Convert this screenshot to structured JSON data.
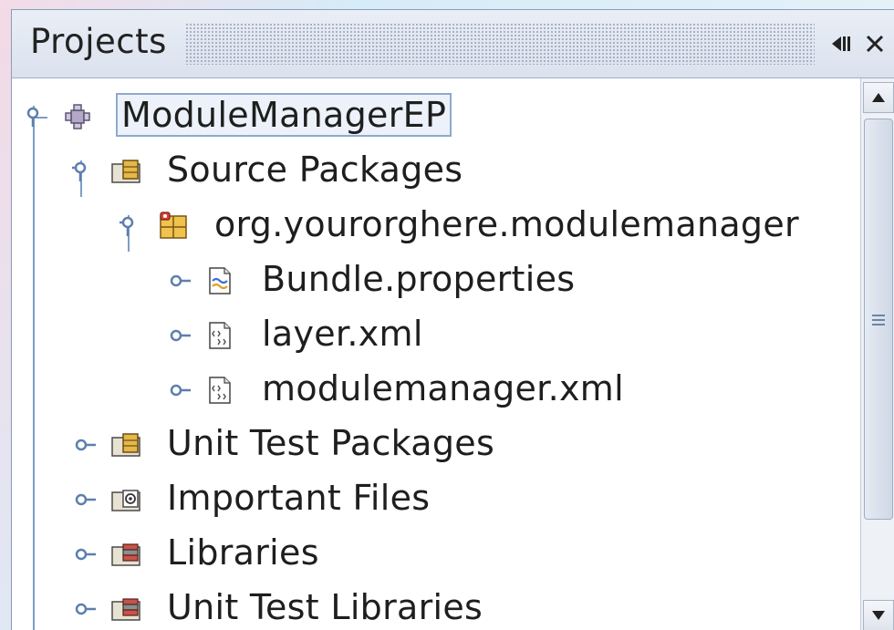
{
  "panel": {
    "title": "Projects",
    "minimize_glyph": "◀▮",
    "close_glyph": "✕"
  },
  "tree": {
    "nodes": [
      {
        "label": "ModuleManagerEP",
        "icon": "module-icon",
        "state": "expanded",
        "selected": true
      },
      {
        "label": "Source Packages",
        "icon": "package-folder-icon",
        "state": "expanded"
      },
      {
        "label": "org.yourorghere.modulemanager",
        "icon": "java-package-icon",
        "state": "expanded"
      },
      {
        "label": "Bundle.properties",
        "icon": "properties-file-icon",
        "state": "collapsed"
      },
      {
        "label": "layer.xml",
        "icon": "xml-file-icon",
        "state": "collapsed"
      },
      {
        "label": "modulemanager.xml",
        "icon": "xml-file-icon",
        "state": "collapsed"
      },
      {
        "label": "Unit Test Packages",
        "icon": "package-folder-icon",
        "state": "collapsed"
      },
      {
        "label": "Important Files",
        "icon": "important-files-folder-icon",
        "state": "collapsed"
      },
      {
        "label": "Libraries",
        "icon": "libraries-folder-icon",
        "state": "collapsed"
      },
      {
        "label": "Unit Test Libraries",
        "icon": "libraries-folder-icon",
        "state": "collapsed"
      }
    ]
  },
  "colors": {
    "tree_line": "#7d9dc6",
    "selection_outline": "#8fa9cc",
    "titlebar": "#e2e8f2"
  }
}
